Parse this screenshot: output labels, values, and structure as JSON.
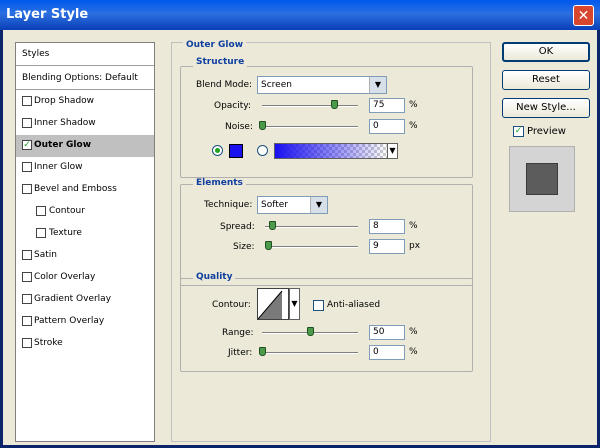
{
  "window": {
    "title": "Layer Style",
    "close_glyph": "✕"
  },
  "styles_list": {
    "header": "Styles",
    "blending": "Blending Options: Default",
    "items": [
      {
        "label": "Drop Shadow",
        "checked": false,
        "indent": false
      },
      {
        "label": "Inner Shadow",
        "checked": false,
        "indent": false
      },
      {
        "label": "Outer Glow",
        "checked": true,
        "indent": false,
        "selected": true
      },
      {
        "label": "Inner Glow",
        "checked": false,
        "indent": false
      },
      {
        "label": "Bevel and Emboss",
        "checked": false,
        "indent": false
      },
      {
        "label": "Contour",
        "checked": false,
        "indent": true
      },
      {
        "label": "Texture",
        "checked": false,
        "indent": true
      },
      {
        "label": "Satin",
        "checked": false,
        "indent": false
      },
      {
        "label": "Color Overlay",
        "checked": false,
        "indent": false
      },
      {
        "label": "Gradient Overlay",
        "checked": false,
        "indent": false
      },
      {
        "label": "Pattern Overlay",
        "checked": false,
        "indent": false
      },
      {
        "label": "Stroke",
        "checked": false,
        "indent": false
      }
    ]
  },
  "outer_glow": {
    "title": "Outer Glow",
    "structure": {
      "title": "Structure",
      "blend_mode_label": "Blend Mode:",
      "blend_mode_value": "Screen",
      "opacity_label": "Opacity:",
      "opacity_value": "75",
      "opacity_unit": "%",
      "opacity_fraction": 0.75,
      "noise_label": "Noise:",
      "noise_value": "0",
      "noise_unit": "%",
      "noise_fraction": 0.0,
      "glow_color": "#1a10f0"
    },
    "elements": {
      "title": "Elements",
      "technique_label": "Technique:",
      "technique_value": "Softer",
      "spread_label": "Spread:",
      "spread_value": "8",
      "spread_unit": "%",
      "spread_fraction": 0.08,
      "size_label": "Size:",
      "size_value": "9",
      "size_unit": "px",
      "size_fraction": 0.036
    },
    "quality": {
      "title": "Quality",
      "contour_label": "Contour:",
      "anti_aliased_label": "Anti-aliased",
      "anti_aliased_checked": false,
      "range_label": "Range:",
      "range_value": "50",
      "range_unit": "%",
      "range_fraction": 0.5,
      "jitter_label": "Jitter:",
      "jitter_value": "0",
      "jitter_unit": "%",
      "jitter_fraction": 0.0
    }
  },
  "buttons": {
    "ok": "OK",
    "reset": "Reset",
    "new_style": "New Style..."
  },
  "preview": {
    "label": "Preview",
    "checked": true
  }
}
